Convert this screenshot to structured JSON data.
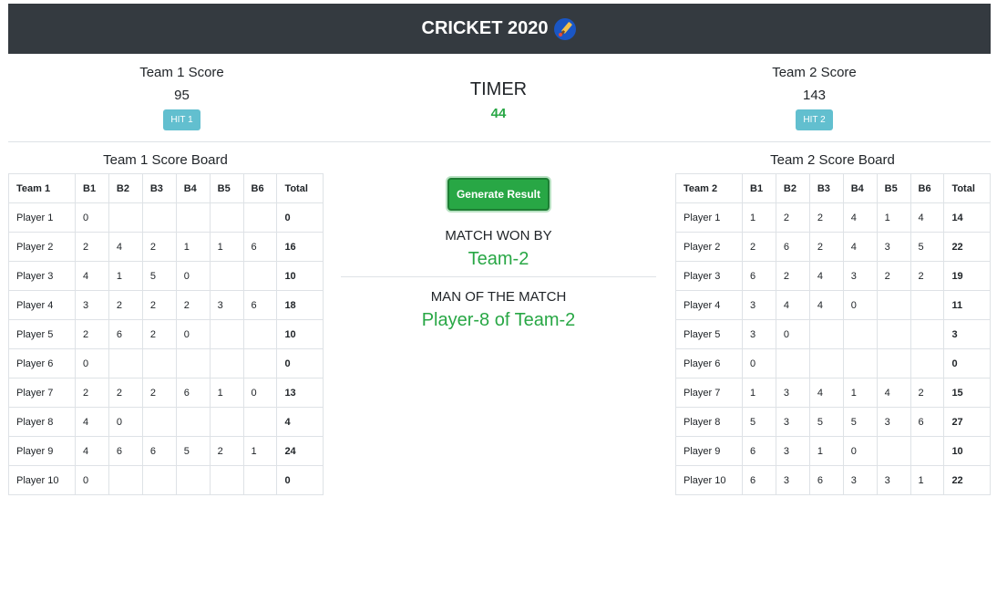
{
  "navbar": {
    "title": "CRICKET 2020",
    "icon": "cricket-bat-icon"
  },
  "team1": {
    "score_title": "Team 1 Score",
    "score": "95",
    "hit_label": "HIT 1"
  },
  "team2": {
    "score_title": "Team 2 Score",
    "score": "143",
    "hit_label": "HIT 2"
  },
  "timer": {
    "label": "TIMER",
    "value": "44"
  },
  "center": {
    "generate_label": "Generate Result",
    "won_label": "MATCH WON BY",
    "won_value": "Team-2",
    "mom_label": "MAN OF THE MATCH",
    "mom_value": "Player-8 of Team-2"
  },
  "board1": {
    "title": "Team 1 Score Board",
    "headers": [
      "Team 1",
      "B1",
      "B2",
      "B3",
      "B4",
      "B5",
      "B6",
      "Total"
    ],
    "rows": [
      [
        "Player 1",
        "0",
        "",
        "",
        "",
        "",
        "",
        "0"
      ],
      [
        "Player 2",
        "2",
        "4",
        "2",
        "1",
        "1",
        "6",
        "16"
      ],
      [
        "Player 3",
        "4",
        "1",
        "5",
        "0",
        "",
        "",
        "10"
      ],
      [
        "Player 4",
        "3",
        "2",
        "2",
        "2",
        "3",
        "6",
        "18"
      ],
      [
        "Player 5",
        "2",
        "6",
        "2",
        "0",
        "",
        "",
        "10"
      ],
      [
        "Player 6",
        "0",
        "",
        "",
        "",
        "",
        "",
        "0"
      ],
      [
        "Player 7",
        "2",
        "2",
        "2",
        "6",
        "1",
        "0",
        "13"
      ],
      [
        "Player 8",
        "4",
        "0",
        "",
        "",
        "",
        "",
        "4"
      ],
      [
        "Player 9",
        "4",
        "6",
        "6",
        "5",
        "2",
        "1",
        "24"
      ],
      [
        "Player 10",
        "0",
        "",
        "",
        "",
        "",
        "",
        "0"
      ]
    ]
  },
  "board2": {
    "title": "Team 2 Score Board",
    "headers": [
      "Team 2",
      "B1",
      "B2",
      "B3",
      "B4",
      "B5",
      "B6",
      "Total"
    ],
    "rows": [
      [
        "Player 1",
        "1",
        "2",
        "2",
        "4",
        "1",
        "4",
        "14"
      ],
      [
        "Player 2",
        "2",
        "6",
        "2",
        "4",
        "3",
        "5",
        "22"
      ],
      [
        "Player 3",
        "6",
        "2",
        "4",
        "3",
        "2",
        "2",
        "19"
      ],
      [
        "Player 4",
        "3",
        "4",
        "4",
        "0",
        "",
        "",
        "11"
      ],
      [
        "Player 5",
        "3",
        "0",
        "",
        "",
        "",
        "",
        "3"
      ],
      [
        "Player 6",
        "0",
        "",
        "",
        "",
        "",
        "",
        "0"
      ],
      [
        "Player 7",
        "1",
        "3",
        "4",
        "1",
        "4",
        "2",
        "15"
      ],
      [
        "Player 8",
        "5",
        "3",
        "5",
        "5",
        "3",
        "6",
        "27"
      ],
      [
        "Player 9",
        "6",
        "3",
        "1",
        "0",
        "",
        "",
        "10"
      ],
      [
        "Player 10",
        "6",
        "3",
        "6",
        "3",
        "3",
        "1",
        "22"
      ]
    ]
  },
  "colors": {
    "navbar": "#343a40",
    "success": "#28a745",
    "info": "#62bfcf"
  }
}
